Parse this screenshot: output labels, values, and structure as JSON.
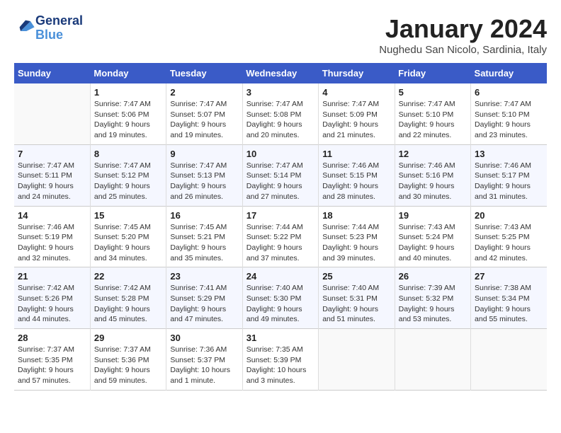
{
  "logo": {
    "line1": "General",
    "line2": "Blue"
  },
  "title": "January 2024",
  "subtitle": "Nughedu San Nicolo, Sardinia, Italy",
  "weekdays": [
    "Sunday",
    "Monday",
    "Tuesday",
    "Wednesday",
    "Thursday",
    "Friday",
    "Saturday"
  ],
  "weeks": [
    [
      {
        "num": "",
        "info": ""
      },
      {
        "num": "1",
        "info": "Sunrise: 7:47 AM\nSunset: 5:06 PM\nDaylight: 9 hours\nand 19 minutes."
      },
      {
        "num": "2",
        "info": "Sunrise: 7:47 AM\nSunset: 5:07 PM\nDaylight: 9 hours\nand 19 minutes."
      },
      {
        "num": "3",
        "info": "Sunrise: 7:47 AM\nSunset: 5:08 PM\nDaylight: 9 hours\nand 20 minutes."
      },
      {
        "num": "4",
        "info": "Sunrise: 7:47 AM\nSunset: 5:09 PM\nDaylight: 9 hours\nand 21 minutes."
      },
      {
        "num": "5",
        "info": "Sunrise: 7:47 AM\nSunset: 5:10 PM\nDaylight: 9 hours\nand 22 minutes."
      },
      {
        "num": "6",
        "info": "Sunrise: 7:47 AM\nSunset: 5:10 PM\nDaylight: 9 hours\nand 23 minutes."
      }
    ],
    [
      {
        "num": "7",
        "info": "Sunrise: 7:47 AM\nSunset: 5:11 PM\nDaylight: 9 hours\nand 24 minutes."
      },
      {
        "num": "8",
        "info": "Sunrise: 7:47 AM\nSunset: 5:12 PM\nDaylight: 9 hours\nand 25 minutes."
      },
      {
        "num": "9",
        "info": "Sunrise: 7:47 AM\nSunset: 5:13 PM\nDaylight: 9 hours\nand 26 minutes."
      },
      {
        "num": "10",
        "info": "Sunrise: 7:47 AM\nSunset: 5:14 PM\nDaylight: 9 hours\nand 27 minutes."
      },
      {
        "num": "11",
        "info": "Sunrise: 7:46 AM\nSunset: 5:15 PM\nDaylight: 9 hours\nand 28 minutes."
      },
      {
        "num": "12",
        "info": "Sunrise: 7:46 AM\nSunset: 5:16 PM\nDaylight: 9 hours\nand 30 minutes."
      },
      {
        "num": "13",
        "info": "Sunrise: 7:46 AM\nSunset: 5:17 PM\nDaylight: 9 hours\nand 31 minutes."
      }
    ],
    [
      {
        "num": "14",
        "info": "Sunrise: 7:46 AM\nSunset: 5:19 PM\nDaylight: 9 hours\nand 32 minutes."
      },
      {
        "num": "15",
        "info": "Sunrise: 7:45 AM\nSunset: 5:20 PM\nDaylight: 9 hours\nand 34 minutes."
      },
      {
        "num": "16",
        "info": "Sunrise: 7:45 AM\nSunset: 5:21 PM\nDaylight: 9 hours\nand 35 minutes."
      },
      {
        "num": "17",
        "info": "Sunrise: 7:44 AM\nSunset: 5:22 PM\nDaylight: 9 hours\nand 37 minutes."
      },
      {
        "num": "18",
        "info": "Sunrise: 7:44 AM\nSunset: 5:23 PM\nDaylight: 9 hours\nand 39 minutes."
      },
      {
        "num": "19",
        "info": "Sunrise: 7:43 AM\nSunset: 5:24 PM\nDaylight: 9 hours\nand 40 minutes."
      },
      {
        "num": "20",
        "info": "Sunrise: 7:43 AM\nSunset: 5:25 PM\nDaylight: 9 hours\nand 42 minutes."
      }
    ],
    [
      {
        "num": "21",
        "info": "Sunrise: 7:42 AM\nSunset: 5:26 PM\nDaylight: 9 hours\nand 44 minutes."
      },
      {
        "num": "22",
        "info": "Sunrise: 7:42 AM\nSunset: 5:28 PM\nDaylight: 9 hours\nand 45 minutes."
      },
      {
        "num": "23",
        "info": "Sunrise: 7:41 AM\nSunset: 5:29 PM\nDaylight: 9 hours\nand 47 minutes."
      },
      {
        "num": "24",
        "info": "Sunrise: 7:40 AM\nSunset: 5:30 PM\nDaylight: 9 hours\nand 49 minutes."
      },
      {
        "num": "25",
        "info": "Sunrise: 7:40 AM\nSunset: 5:31 PM\nDaylight: 9 hours\nand 51 minutes."
      },
      {
        "num": "26",
        "info": "Sunrise: 7:39 AM\nSunset: 5:32 PM\nDaylight: 9 hours\nand 53 minutes."
      },
      {
        "num": "27",
        "info": "Sunrise: 7:38 AM\nSunset: 5:34 PM\nDaylight: 9 hours\nand 55 minutes."
      }
    ],
    [
      {
        "num": "28",
        "info": "Sunrise: 7:37 AM\nSunset: 5:35 PM\nDaylight: 9 hours\nand 57 minutes."
      },
      {
        "num": "29",
        "info": "Sunrise: 7:37 AM\nSunset: 5:36 PM\nDaylight: 9 hours\nand 59 minutes."
      },
      {
        "num": "30",
        "info": "Sunrise: 7:36 AM\nSunset: 5:37 PM\nDaylight: 10 hours\nand 1 minute."
      },
      {
        "num": "31",
        "info": "Sunrise: 7:35 AM\nSunset: 5:39 PM\nDaylight: 10 hours\nand 3 minutes."
      },
      {
        "num": "",
        "info": ""
      },
      {
        "num": "",
        "info": ""
      },
      {
        "num": "",
        "info": ""
      }
    ]
  ]
}
